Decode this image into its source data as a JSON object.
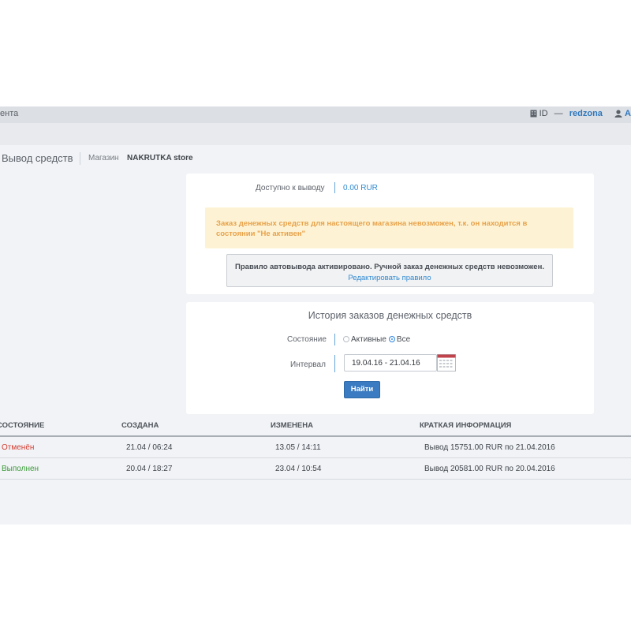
{
  "topbar": {
    "left_text": "ента",
    "id_label": "ID",
    "dash": "—",
    "username": "redzona",
    "user_menu": "A",
    "colors": {
      "link": "#2f77bd"
    }
  },
  "page": {
    "title": "Вывод средств",
    "shop_label": "Магазин",
    "shop_name": "NAKRUTKA store"
  },
  "balance": {
    "label": "Доступно к выводу",
    "value": "0.00 RUR"
  },
  "warning": {
    "text": "Заказ денежных средств для настоящего магазина невозможен, т.к. он находится в состоянии \"Не активен\""
  },
  "auto_rule": {
    "message": "Правило автовывода активировано. Ручной заказ денежных средств невозможен.",
    "edit_link": "Редактировать правило"
  },
  "history": {
    "title": "История заказов денежных средств",
    "state_label": "Состояние",
    "state_options": [
      {
        "label": "Активные",
        "selected": false
      },
      {
        "label": "Все",
        "selected": true
      }
    ],
    "interval_label": "Интервал",
    "interval_value": "19.04.16 - 21.04.16",
    "find_button": "Найти",
    "icons": {
      "calendar": "calendar-icon"
    }
  },
  "table": {
    "headers": [
      "СОСТОЯНИЕ",
      "СОЗДАНА",
      "ИЗМЕНЕНА",
      "КРАТКАЯ ИНФОРМАЦИЯ"
    ],
    "rows": [
      {
        "status": "Отменён",
        "status_color": "#d33b2f",
        "created": "21.04 / 06:24",
        "changed": "13.05 / 14:11",
        "info": "Вывод 15751.00 RUR по 21.04.2016"
      },
      {
        "status": "Выполнен",
        "status_color": "#3c9a3a",
        "created": "20.04 / 18:27",
        "changed": "23.04 / 10:54",
        "info": "Вывод 20581.00 RUR по 20.04.2016"
      }
    ]
  }
}
